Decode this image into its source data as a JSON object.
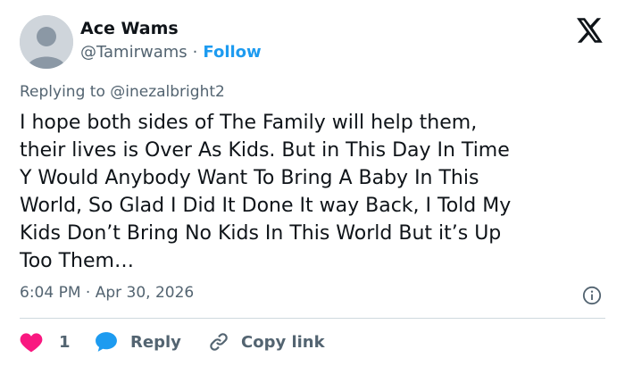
{
  "tweet": {
    "author_name": "Ace Wams",
    "handle": "@Tamirwams",
    "separator": "·",
    "follow_label": "Follow",
    "replying_prefix": "Replying to",
    "replying_to": "@inezalbright2",
    "lines": [
      "I hope both sides of The Family will help them,",
      "their lives is Over As Kids. But in This Day In Time",
      "Y Would Anybody Want To Bring A Baby In This",
      "World, So Glad I Did It Done It way Back, I Told My",
      "Kids Don’t Bring No Kids In This World But it’s Up",
      "Too Them…"
    ],
    "timestamp": "6:04 PM · Apr 30, 2026"
  },
  "actions": {
    "like_count": "1",
    "reply_label": "Reply",
    "copy_link_label": "Copy link"
  },
  "icons": {
    "logo": "x-logo-icon",
    "info": "info-icon",
    "like": "heart-icon",
    "reply": "speech-bubble-icon",
    "copy": "link-icon"
  },
  "colors": {
    "accent": "#1d9bf0",
    "like": "#f91880",
    "text": "#0f1419",
    "muted": "#536471",
    "divider": "#cfd9de"
  }
}
